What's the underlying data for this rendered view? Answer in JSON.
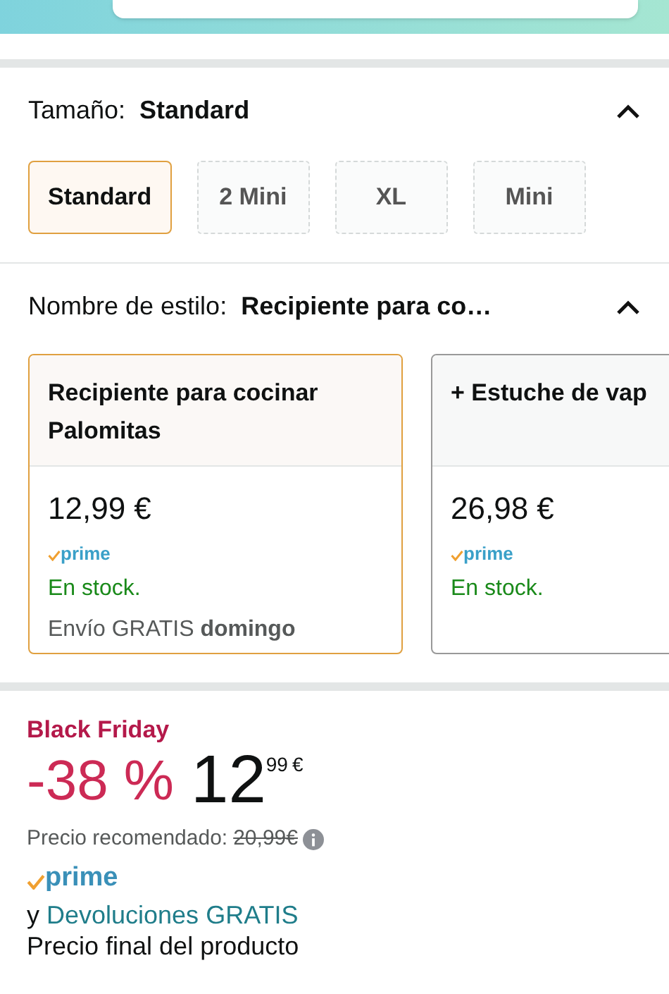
{
  "size": {
    "label": "Tamaño:",
    "value": "Standard",
    "expanded": true,
    "options": [
      {
        "label": "Standard",
        "selected": true
      },
      {
        "label": "2 Mini",
        "selected": false
      },
      {
        "label": "XL",
        "selected": false
      },
      {
        "label": "Mini",
        "selected": false
      }
    ]
  },
  "style": {
    "label": "Nombre de estilo:",
    "value": "Recipiente para co…",
    "expanded": true,
    "options": [
      {
        "title": "Recipiente para cocinar Palomitas",
        "price": "12,99 €",
        "prime": "prime",
        "stock": "En stock.",
        "shipping": "Envío GRATIS **domingo**",
        "selected": true
      },
      {
        "title": "+ Estuche de vap",
        "price": "26,98 €",
        "prime": "prime",
        "stock": "En stock.",
        "selected": false
      }
    ]
  },
  "deal": {
    "badge": "Black Friday",
    "discount": "-38 %",
    "price_whole": "12",
    "price_fraction": "99",
    "currency": "€",
    "list_price_label": "Precio recomendado:",
    "list_price": "20,99€",
    "prime": "prime",
    "returns_prefix": "y",
    "returns_link": "Devoluciones GRATIS",
    "final_note": "Precio final del producto"
  }
}
